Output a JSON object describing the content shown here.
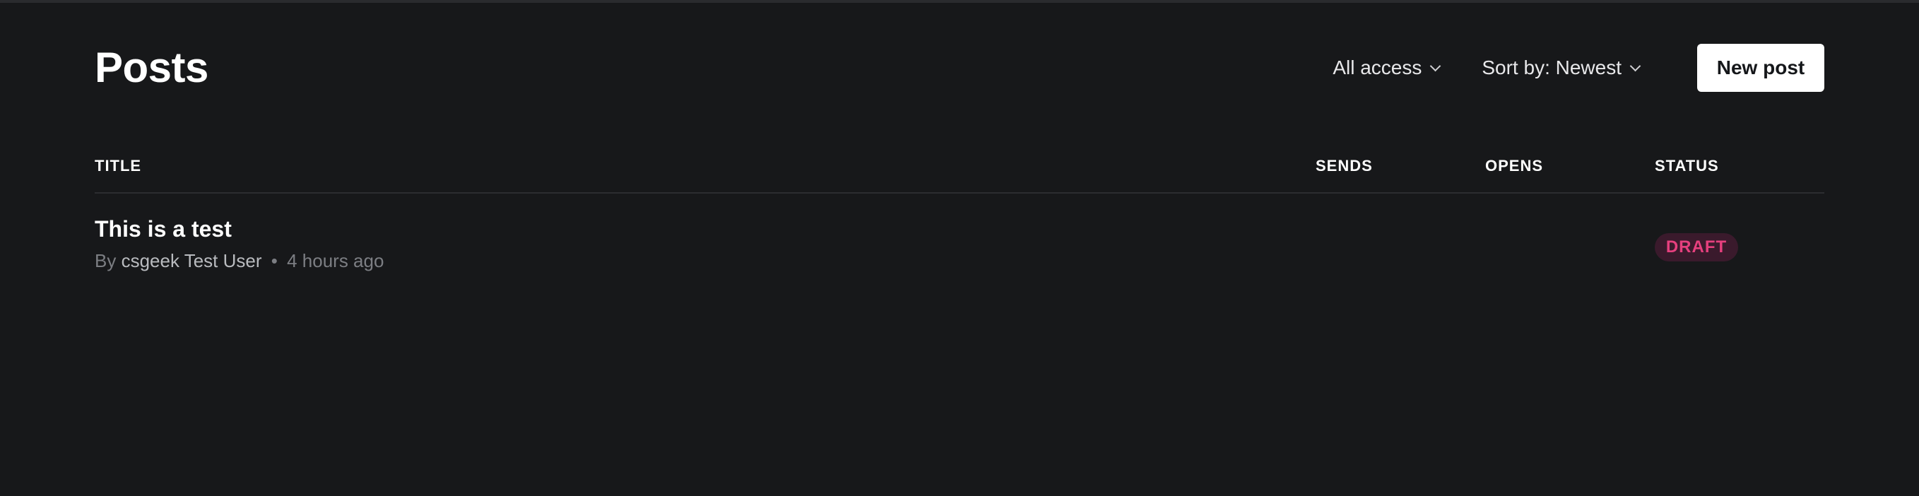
{
  "header": {
    "title": "Posts",
    "access_filter": "All access",
    "sort_filter": "Sort by: Newest",
    "new_post_label": "New post"
  },
  "table": {
    "columns": {
      "title": "TITLE",
      "sends": "SENDS",
      "opens": "OPENS",
      "status": "STATUS"
    },
    "rows": [
      {
        "title": "This is a test",
        "by": "By",
        "author": "csgeek Test User",
        "separator": "•",
        "time": "4 hours ago",
        "status": "DRAFT"
      }
    ]
  },
  "colors": {
    "background": "#17181a",
    "draft_text": "#e6407e",
    "draft_bg": "#3a1a2c"
  }
}
